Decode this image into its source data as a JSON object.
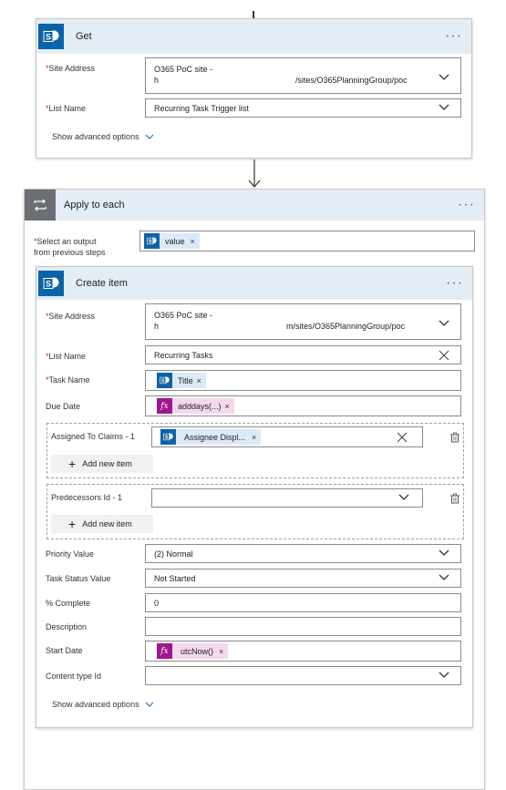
{
  "get_card": {
    "title": "Get",
    "menu": "···",
    "site_address_label": "Site Address",
    "site_address_line1": "O365 PoC site -",
    "site_address_line2_prefix": "h",
    "site_address_line2_suffix": "/sites/O365PlanningGroup/poc",
    "list_name_label": "List Name",
    "list_name_value": "Recurring Task Trigger list",
    "show_advanced": "Show advanced options"
  },
  "apply_card": {
    "title": "Apply to each",
    "menu": "···",
    "select_output_label_line1": "Select an output",
    "select_output_label_line2": "from previous steps",
    "select_output_token": "value"
  },
  "create_card": {
    "title": "Create item",
    "menu": "···",
    "site_address_label": "Site Address",
    "site_address_line1": "O365 PoC site -",
    "site_address_line2_prefix": "h",
    "site_address_line2_suffix": "m/sites/O365PlanningGroup/poc",
    "list_name_label": "List Name",
    "list_name_value": "Recurring Tasks",
    "task_name_label": "Task Name",
    "task_name_token": "Title",
    "due_date_label": "Due Date",
    "due_date_token": "adddays(...)",
    "assigned_label": "Assigned To Claims - 1",
    "assigned_token": "Assignee Displ...",
    "add_new_item": "Add new item",
    "predecessors_label": "Predecessors Id - 1",
    "priority_label": "Priority Value",
    "priority_value": "(2) Normal",
    "task_status_label": "Task Status Value",
    "task_status_value": "Not Started",
    "percent_label": "% Complete",
    "percent_value": "0",
    "description_label": "Description",
    "description_value": "",
    "start_date_label": "Start Date",
    "start_date_token": "utcNow()",
    "content_type_label": "Content type Id",
    "content_type_value": "",
    "show_advanced": "Show advanced options"
  },
  "tokens": {
    "remove_glyph": "×",
    "fx_glyph": "fx"
  },
  "colors": {
    "sharepoint_blue": "#0b63a8",
    "expression_purple": "#a0178c",
    "apply_header_gray": "#6b6e73",
    "header_bg": "#e4ecf6",
    "link_blue": "#2a72c4",
    "required_red": "#c62828"
  }
}
